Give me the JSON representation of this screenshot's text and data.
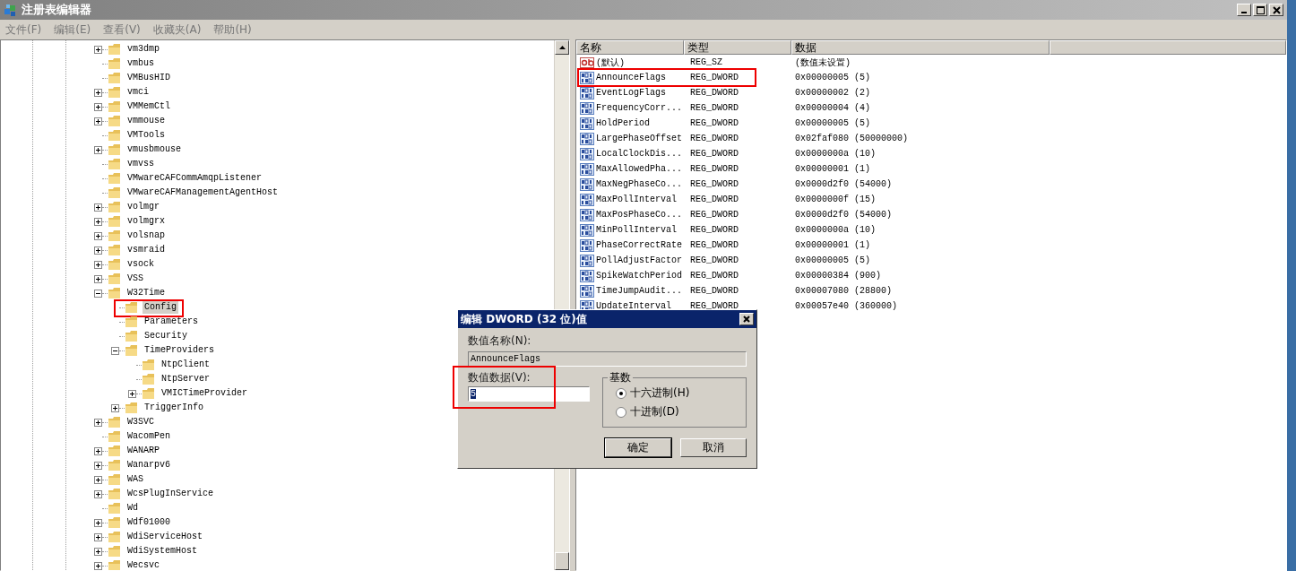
{
  "window": {
    "title": "注册表编辑器"
  },
  "menu": [
    "文件(F)",
    "编辑(E)",
    "查看(V)",
    "收藏夹(A)",
    "帮助(H)"
  ],
  "tree": [
    {
      "label": "vm3dmp",
      "expandable": true,
      "expanded": false,
      "selected": false
    },
    {
      "label": "vmbus",
      "expandable": false,
      "selected": false
    },
    {
      "label": "VMBusHID",
      "expandable": false,
      "selected": false
    },
    {
      "label": "vmci",
      "expandable": true,
      "expanded": false,
      "selected": false
    },
    {
      "label": "VMMemCtl",
      "expandable": true,
      "expanded": false,
      "selected": false
    },
    {
      "label": "vmmouse",
      "expandable": true,
      "expanded": false,
      "selected": false
    },
    {
      "label": "VMTools",
      "expandable": false,
      "selected": false
    },
    {
      "label": "vmusbmouse",
      "expandable": true,
      "expanded": false,
      "selected": false
    },
    {
      "label": "vmvss",
      "expandable": false,
      "selected": false
    },
    {
      "label": "VMwareCAFCommAmqpListener",
      "expandable": false,
      "selected": false
    },
    {
      "label": "VMwareCAFManagementAgentHost",
      "expandable": false,
      "selected": false
    },
    {
      "label": "volmgr",
      "expandable": true,
      "expanded": false,
      "selected": false
    },
    {
      "label": "volmgrx",
      "expandable": true,
      "expanded": false,
      "selected": false
    },
    {
      "label": "volsnap",
      "expandable": true,
      "expanded": false,
      "selected": false
    },
    {
      "label": "vsmraid",
      "expandable": true,
      "expanded": false,
      "selected": false
    },
    {
      "label": "vsock",
      "expandable": true,
      "expanded": false,
      "selected": false
    },
    {
      "label": "VSS",
      "expandable": true,
      "expanded": false,
      "selected": false
    },
    {
      "label": "W32Time",
      "expandable": true,
      "expanded": true,
      "selected": false,
      "children": [
        {
          "label": "Config",
          "expandable": false,
          "selected": true,
          "boxed": true
        },
        {
          "label": "Parameters",
          "expandable": false,
          "selected": false
        },
        {
          "label": "Security",
          "expandable": false,
          "selected": false
        },
        {
          "label": "TimeProviders",
          "expandable": true,
          "expanded": true,
          "selected": false,
          "children": [
            {
              "label": "NtpClient",
              "expandable": false,
              "selected": false
            },
            {
              "label": "NtpServer",
              "expandable": false,
              "selected": false
            },
            {
              "label": "VMICTimeProvider",
              "expandable": true,
              "expanded": false,
              "selected": false
            }
          ]
        },
        {
          "label": "TriggerInfo",
          "expandable": true,
          "expanded": false,
          "selected": false
        }
      ]
    },
    {
      "label": "W3SVC",
      "expandable": true,
      "expanded": false,
      "selected": false
    },
    {
      "label": "WacomPen",
      "expandable": false,
      "selected": false
    },
    {
      "label": "WANARP",
      "expandable": true,
      "expanded": false,
      "selected": false
    },
    {
      "label": "Wanarpv6",
      "expandable": true,
      "expanded": false,
      "selected": false
    },
    {
      "label": "WAS",
      "expandable": true,
      "expanded": false,
      "selected": false
    },
    {
      "label": "WcsPlugInService",
      "expandable": true,
      "expanded": false,
      "selected": false
    },
    {
      "label": "Wd",
      "expandable": false,
      "selected": false
    },
    {
      "label": "Wdf01000",
      "expandable": true,
      "expanded": false,
      "selected": false
    },
    {
      "label": "WdiServiceHost",
      "expandable": true,
      "expanded": false,
      "selected": false
    },
    {
      "label": "WdiSystemHost",
      "expandable": true,
      "expanded": false,
      "selected": false
    },
    {
      "label": "Wecsvc",
      "expandable": true,
      "expanded": false,
      "selected": false
    }
  ],
  "values": {
    "columns": [
      "名称",
      "类型",
      "数据"
    ],
    "rows": [
      {
        "kind": "string",
        "name": "(默认)",
        "type": "REG_SZ",
        "data": "(数值未设置)"
      },
      {
        "kind": "dword",
        "name": "AnnounceFlags",
        "type": "REG_DWORD",
        "data": "0x00000005 (5)",
        "boxed": true
      },
      {
        "kind": "dword",
        "name": "EventLogFlags",
        "type": "REG_DWORD",
        "data": "0x00000002 (2)"
      },
      {
        "kind": "dword",
        "name": "FrequencyCorr...",
        "type": "REG_DWORD",
        "data": "0x00000004 (4)"
      },
      {
        "kind": "dword",
        "name": "HoldPeriod",
        "type": "REG_DWORD",
        "data": "0x00000005 (5)"
      },
      {
        "kind": "dword",
        "name": "LargePhaseOffset",
        "type": "REG_DWORD",
        "data": "0x02faf080 (50000000)"
      },
      {
        "kind": "dword",
        "name": "LocalClockDis...",
        "type": "REG_DWORD",
        "data": "0x0000000a (10)"
      },
      {
        "kind": "dword",
        "name": "MaxAllowedPha...",
        "type": "REG_DWORD",
        "data": "0x00000001 (1)"
      },
      {
        "kind": "dword",
        "name": "MaxNegPhaseCo...",
        "type": "REG_DWORD",
        "data": "0x0000d2f0 (54000)"
      },
      {
        "kind": "dword",
        "name": "MaxPollInterval",
        "type": "REG_DWORD",
        "data": "0x0000000f (15)"
      },
      {
        "kind": "dword",
        "name": "MaxPosPhaseCo...",
        "type": "REG_DWORD",
        "data": "0x0000d2f0 (54000)"
      },
      {
        "kind": "dword",
        "name": "MinPollInterval",
        "type": "REG_DWORD",
        "data": "0x0000000a (10)"
      },
      {
        "kind": "dword",
        "name": "PhaseCorrectRate",
        "type": "REG_DWORD",
        "data": "0x00000001 (1)"
      },
      {
        "kind": "dword",
        "name": "PollAdjustFactor",
        "type": "REG_DWORD",
        "data": "0x00000005 (5)"
      },
      {
        "kind": "dword",
        "name": "SpikeWatchPeriod",
        "type": "REG_DWORD",
        "data": "0x00000384 (900)"
      },
      {
        "kind": "dword",
        "name": "TimeJumpAudit...",
        "type": "REG_DWORD",
        "data": "0x00007080 (28800)"
      },
      {
        "kind": "dword",
        "name": "UpdateInterval",
        "type": "REG_DWORD",
        "data": "0x00057e40 (360000)"
      }
    ]
  },
  "dialog": {
    "title": "编辑 DWORD (32 位)值",
    "name_label": "数值名称(N):",
    "name_value": "AnnounceFlags",
    "data_label": "数值数据(V):",
    "data_value": "5",
    "data_boxed": true,
    "base_label": "基数",
    "bases": [
      {
        "label": "十六进制(H)",
        "selected": true
      },
      {
        "label": "十进制(D)",
        "selected": false
      }
    ],
    "buttons": [
      {
        "label": "确定",
        "default": true
      },
      {
        "label": "取消",
        "default": false
      }
    ]
  }
}
